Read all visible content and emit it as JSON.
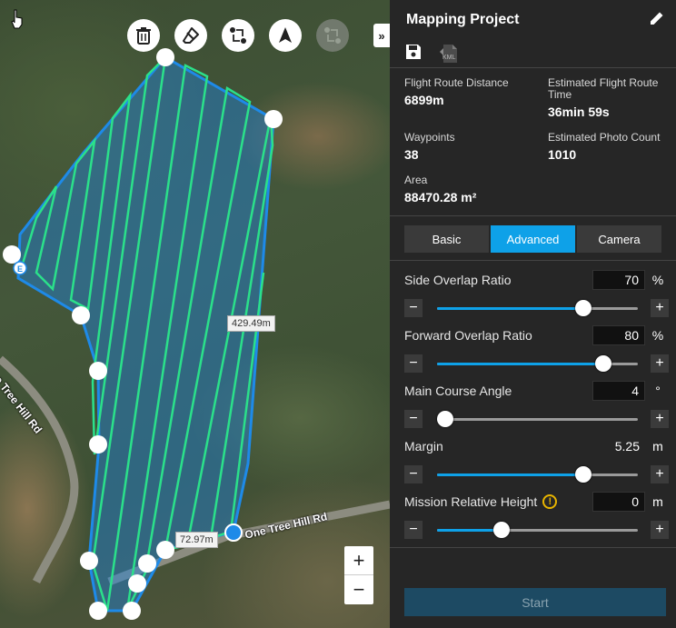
{
  "map": {
    "road_labels": [
      "One Tree Hill Rd",
      "One Tree Hill Rd"
    ],
    "distance_labels": [
      "429.49m",
      "72.97m"
    ],
    "endpoint_label": "E",
    "toolbar": {
      "delete_icon": "trash-icon",
      "clear_icon": "eraser-icon",
      "reverse_icon": "route-swap-icon",
      "direction_icon": "drone-direction-icon",
      "disabled_icon": "route-swap-disabled-icon"
    },
    "collapse_glyph": "»",
    "zoom_in": "+",
    "zoom_out": "−"
  },
  "panel": {
    "title": "Mapping Project",
    "edit_icon": "pencil-icon",
    "save_icon": "save-icon",
    "kml_icon": "kml-export-icon",
    "kml_text": "KML",
    "stats": [
      {
        "label": "Flight Route Distance",
        "value": "6899m"
      },
      {
        "label": "Estimated Flight Route Time",
        "value": "36min 59s"
      },
      {
        "label": "Waypoints",
        "value": "38"
      },
      {
        "label": "Estimated Photo Count",
        "value": "1010"
      },
      {
        "label": "Area",
        "value": "88470.28 m²"
      }
    ],
    "tabs": [
      {
        "label": "Basic",
        "active": false
      },
      {
        "label": "Advanced",
        "active": true
      },
      {
        "label": "Camera",
        "active": false
      }
    ],
    "params": [
      {
        "label": "Side Overlap Ratio",
        "value": "70",
        "unit": "%",
        "slider": 0.73,
        "boxed": true
      },
      {
        "label": "Forward Overlap Ratio",
        "value": "80",
        "unit": "%",
        "slider": 0.83,
        "boxed": true
      },
      {
        "label": "Main Course Angle",
        "value": "4",
        "unit": "°",
        "slider": 0.04,
        "boxed": true
      },
      {
        "label": "Margin",
        "value": "5.25",
        "unit": "m",
        "slider": 0.73,
        "boxed": false
      },
      {
        "label": "Mission Relative Height",
        "value": "0",
        "unit": "m",
        "slider": 0.32,
        "boxed": true,
        "warning": true
      }
    ],
    "minus": "−",
    "plus": "+",
    "start_label": "Start",
    "accent": "#0ea1e8"
  }
}
